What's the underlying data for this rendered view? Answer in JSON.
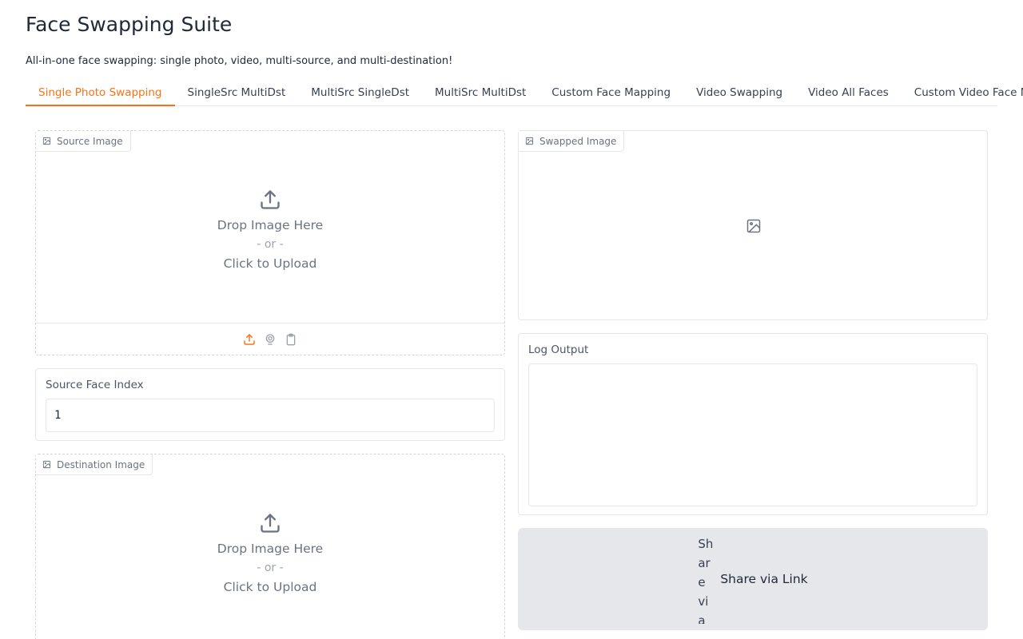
{
  "app": {
    "title": "Face Swapping Suite",
    "description": "All-in-one face swapping: single photo, video, multi-source, and multi-destination!"
  },
  "tabs": [
    {
      "label": "Single Photo Swapping",
      "active": true
    },
    {
      "label": "SingleSrc MultiDst",
      "active": false
    },
    {
      "label": "MultiSrc SingleDst",
      "active": false
    },
    {
      "label": "MultiSrc MultiDst",
      "active": false
    },
    {
      "label": "Custom Face Mapping",
      "active": false
    },
    {
      "label": "Video Swapping",
      "active": false
    },
    {
      "label": "Video All Faces",
      "active": false
    },
    {
      "label": "Custom Video Face Mapping",
      "active": false
    }
  ],
  "source_image": {
    "label": "Source Image",
    "drop_text": "Drop Image Here",
    "or_text": "- or -",
    "click_text": "Click to Upload",
    "toolbar_icons": [
      "upload-icon",
      "webcam-icon",
      "clipboard-icon"
    ]
  },
  "source_face_index": {
    "label": "Source Face Index",
    "value": "1"
  },
  "destination_image": {
    "label": "Destination Image",
    "drop_text": "Drop Image Here",
    "or_text": "- or -",
    "click_text": "Click to Upload"
  },
  "swapped_image": {
    "label": "Swapped Image",
    "placeholder_icon": "image-icon"
  },
  "log_output": {
    "label": "Log Output",
    "value": ""
  },
  "share": {
    "label": "Share via Link",
    "icon_alt": "Share via Link icon"
  },
  "colors": {
    "accent": "#f97316",
    "border": "#e5e7eb",
    "button_bg": "#e5e7eb"
  }
}
